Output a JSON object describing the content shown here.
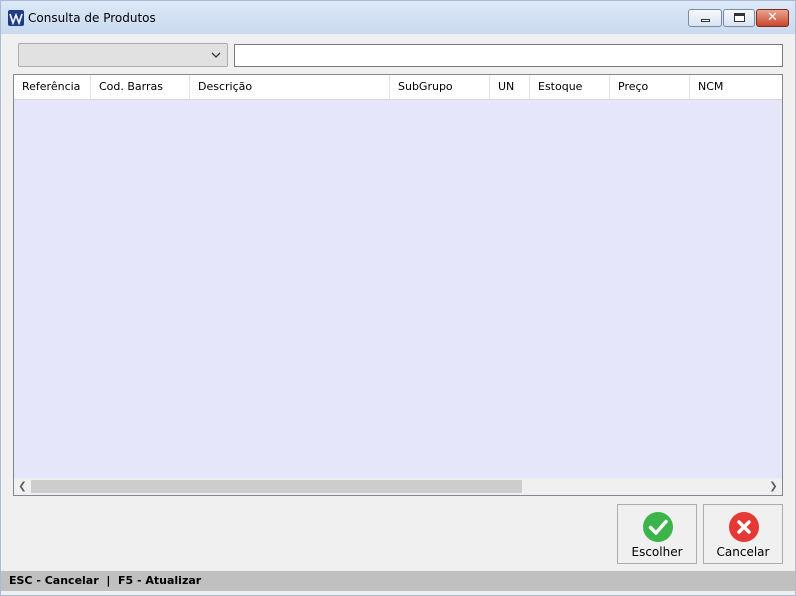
{
  "window": {
    "title": "Consulta de Produtos"
  },
  "filter": {
    "selected": "",
    "search_value": "",
    "search_placeholder": ""
  },
  "grid": {
    "columns": [
      "Referência",
      "Cod. Barras",
      "Descrição",
      "SubGrupo",
      "UN",
      "Estoque",
      "Preço",
      "NCM"
    ],
    "rows": []
  },
  "actions": {
    "choose_label": "Escolher",
    "cancel_label": "Cancelar"
  },
  "status": {
    "text": "ESC - Cancelar  |  F5 - Atualizar"
  },
  "colors": {
    "grid_background": "#e6e6fa",
    "choose_green": "#3bb54a",
    "cancel_red": "#e53935",
    "statusbar": "#c0c0c0"
  },
  "icons": {
    "app": "app-logo-icon",
    "choose": "check-circle-icon",
    "cancel": "x-circle-icon",
    "dropdown": "chevron-down-icon"
  }
}
